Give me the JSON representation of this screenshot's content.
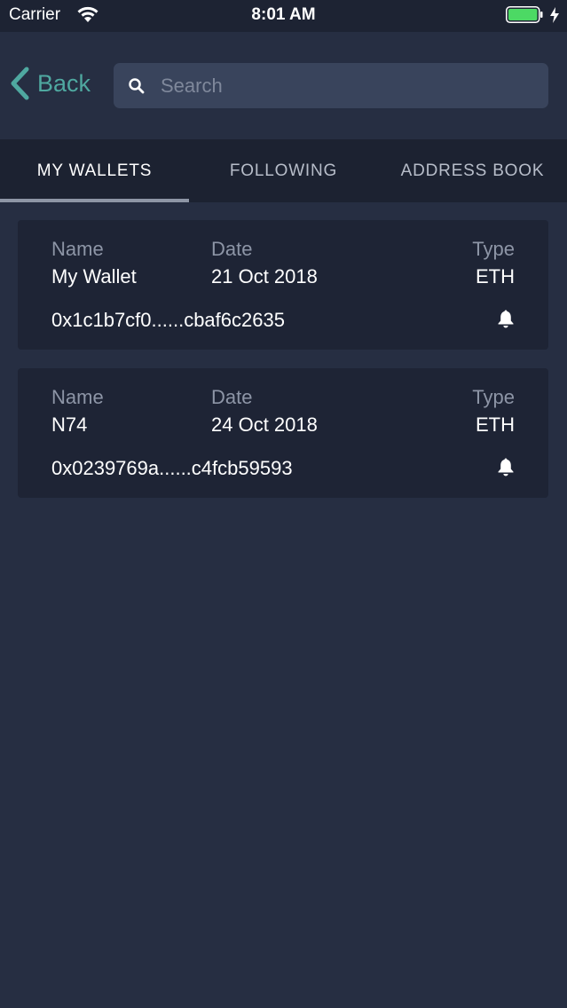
{
  "status_bar": {
    "carrier": "Carrier",
    "time": "8:01 AM",
    "battery_color": "#4cd964"
  },
  "nav": {
    "back_label": "Back",
    "search_placeholder": "Search",
    "search_value": "",
    "accent_color": "#4fa8a0"
  },
  "tabs": [
    {
      "label": "MY WALLETS",
      "active": true
    },
    {
      "label": "FOLLOWING",
      "active": false
    },
    {
      "label": "ADDRESS BOOK",
      "active": false
    }
  ],
  "labels": {
    "name": "Name",
    "date": "Date",
    "type": "Type"
  },
  "wallets": [
    {
      "name": "My Wallet",
      "date": "21 Oct 2018",
      "type": "ETH",
      "address": "0x1c1b7cf0......cbaf6c2635",
      "icon": "bell-icon"
    },
    {
      "name": "N74",
      "date": "24 Oct 2018",
      "type": "ETH",
      "address": "0x0239769a......c4fcb59593",
      "icon": "bell-icon"
    }
  ]
}
